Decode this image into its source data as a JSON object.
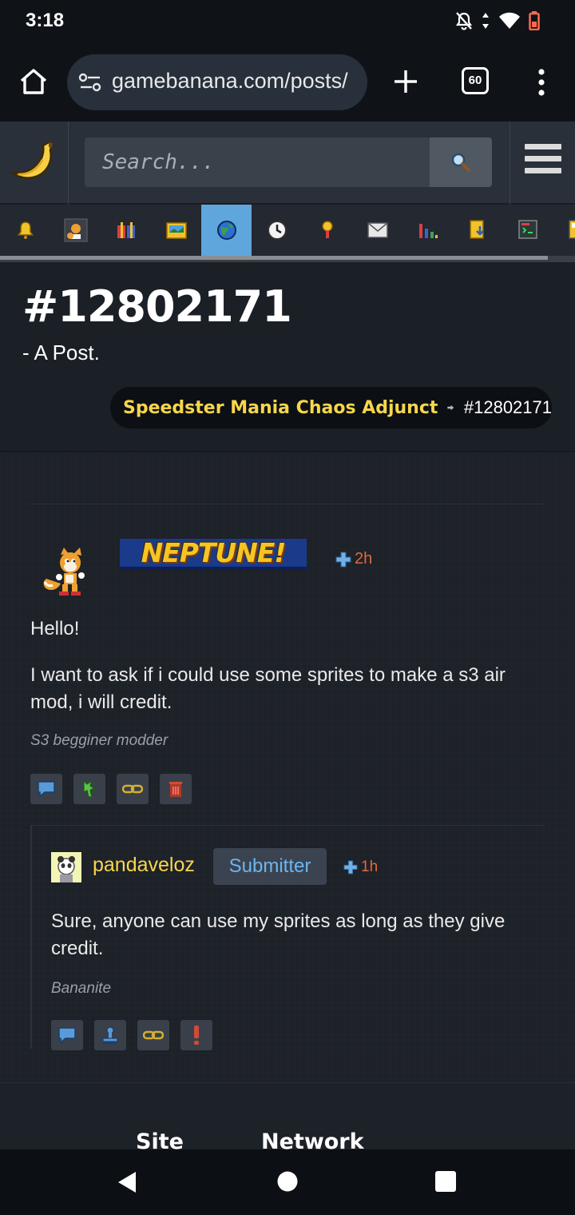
{
  "status_bar": {
    "time": "3:18",
    "icons": [
      "bell-off-icon",
      "data-arrows-icon",
      "wifi-icon",
      "battery-low-icon"
    ]
  },
  "browser": {
    "url": "gamebanana.com/posts/",
    "tab_count": "60"
  },
  "site": {
    "search_placeholder": "Search...",
    "nav_icons": [
      "bell-icon",
      "tails-icon",
      "gifts-icon",
      "image-icon",
      "globe-icon",
      "clock-icon",
      "award-icon",
      "mail-icon",
      "bar-chart-icon",
      "download-icon",
      "code-icon",
      "more-icon"
    ],
    "active_nav_index": 4
  },
  "page": {
    "title": "#12802171",
    "subtitle": "- A Post.",
    "breadcrumb": {
      "link": "Speedster Mania Chaos Adjunct",
      "current": "#12802171"
    }
  },
  "post": {
    "username": "NEPTUNE!",
    "time": "2h",
    "greeting": "Hello!",
    "body": "I want to ask if i could use some sprites to make a s3 air mod, i will credit.",
    "signature": "S3 begginer modder",
    "actions": [
      "reply-icon",
      "wrench-icon",
      "link-icon",
      "trash-icon"
    ]
  },
  "reply": {
    "username": "pandaveloz",
    "badge": "Submitter",
    "time": "1h",
    "body": "Sure, anyone can use my sprites as long as they give credit.",
    "signature": "Bananite",
    "actions": [
      "reply-icon",
      "stamp-icon",
      "link-icon",
      "alert-icon"
    ]
  },
  "footer": {
    "headings": [
      "Site",
      "Network"
    ]
  },
  "colors": {
    "accent_yellow": "#f7d64a",
    "time_orange": "#e06a3c",
    "badge_blue": "#6cb6f0",
    "active_nav": "#5fa6dc"
  }
}
